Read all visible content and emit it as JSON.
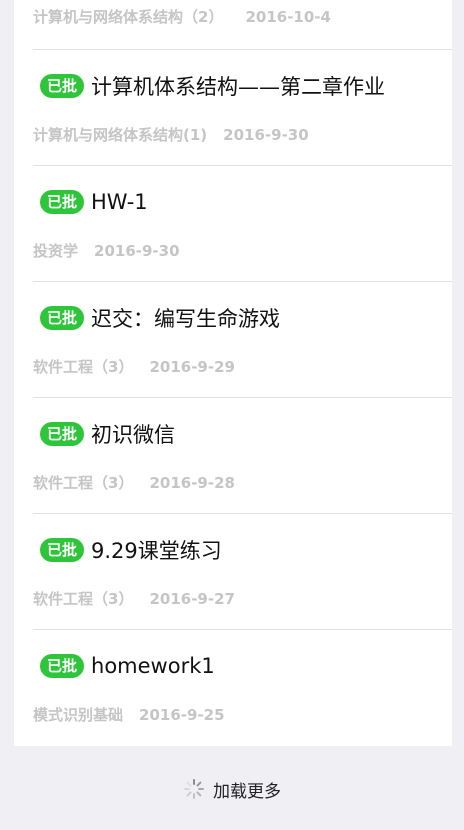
{
  "top_partial": {
    "course": "计算机与网络体系结构（2）",
    "date": "2016-10-4"
  },
  "items": [
    {
      "badge": "已批",
      "title": "计算机体系结构——第二章作业",
      "course": "计算机与网络体系结构(1)",
      "date": "2016-9-30"
    },
    {
      "badge": "已批",
      "title": "HW-1",
      "course": "投资学",
      "date": "2016-9-30"
    },
    {
      "badge": "已批",
      "title": "迟交：编写生命游戏",
      "course": "软件工程（3）",
      "date": "2016-9-29"
    },
    {
      "badge": "已批",
      "title": "初识微信",
      "course": "软件工程（3）",
      "date": "2016-9-28"
    },
    {
      "badge": "已批",
      "title": "9.29课堂练习",
      "course": "软件工程（3）",
      "date": "2016-9-27"
    },
    {
      "badge": "已批",
      "title": "homework1",
      "course": "模式识别基础",
      "date": "2016-9-25"
    }
  ],
  "footer": {
    "load_more": "加载更多",
    "spinner_icon": "loading-spinner-icon"
  },
  "colors": {
    "badge": "#2fc53a",
    "background": "#efeff4",
    "meta_text": "#c5c5c5"
  }
}
